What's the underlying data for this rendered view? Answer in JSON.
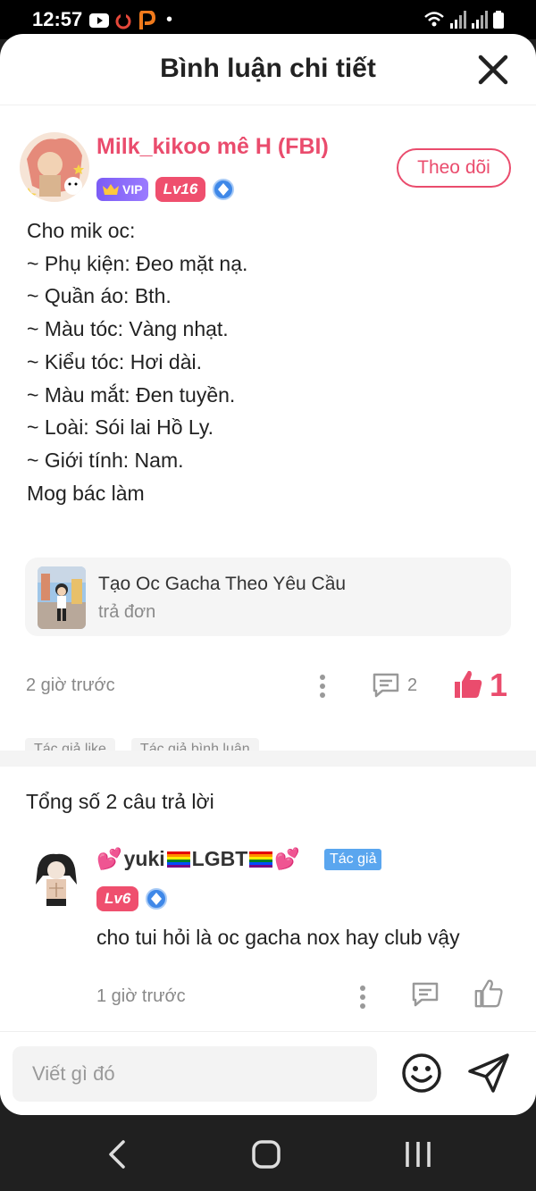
{
  "status_bar": {
    "time": "12:57",
    "dot": "•"
  },
  "header": {
    "title": "Bình luận chi tiết",
    "close_icon": "close-icon"
  },
  "main_comment": {
    "username": "Milk_kikoo mê H (FBI)",
    "vip_label": "VIP",
    "level": "Lv16",
    "follow_label": "Theo dõi",
    "lines": [
      "Cho mik oc:",
      "~ Phụ kiện: Đeo mặt nạ.",
      "~ Quần áo: Bth.",
      "~ Màu tóc: Vàng nhạt.",
      "~ Kiểu tóc: Hơi dài.",
      "~ Màu mắt: Đen tuyền.",
      "~ Loài: Sói lai Hồ Ly.",
      "~ Giới tính: Nam.",
      "Mog bác làm"
    ],
    "ref_card": {
      "title": "Tạo Oc Gacha Theo Yêu Cầu",
      "subtitle": "trả đơn"
    },
    "time": "2 giờ trước",
    "comment_count": "2",
    "like_count": "1",
    "tags": [
      "Tác giả like",
      "Tác giả bình luận"
    ]
  },
  "answers": {
    "title": "Tổng số 2 câu trả lời",
    "reply": {
      "username_text_1": "yuki",
      "username_text_2": "LGBT",
      "author_badge": "Tác giả",
      "level": "Lv6",
      "text": "cho tui hỏi là oc gacha nox hay club vậy",
      "time": "1 giờ trước"
    }
  },
  "input": {
    "placeholder": "Viết gì đó"
  },
  "colors": {
    "accent": "#ea4c6d",
    "author_badge": "#5aa6ef",
    "vip": "#7b5cf5",
    "level_badge": "#ef4f6e"
  }
}
